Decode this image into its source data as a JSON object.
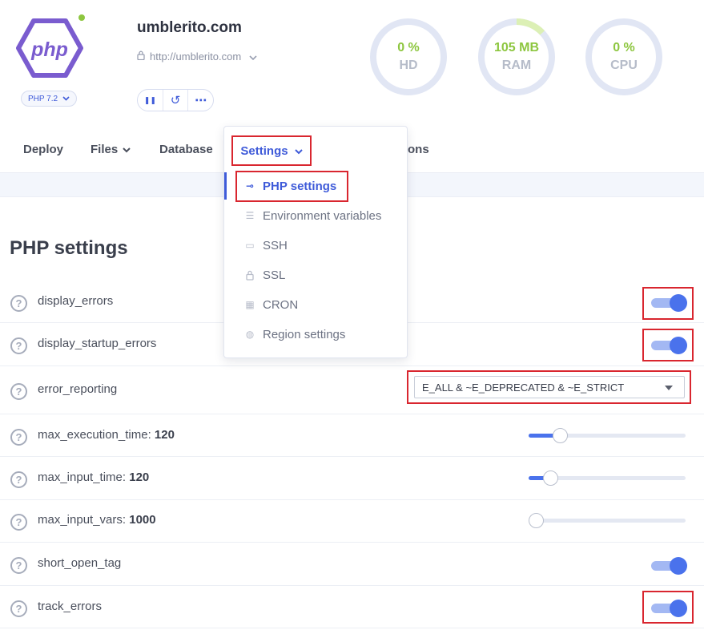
{
  "header": {
    "site_name": "umblerito.com",
    "url": "http://umblerito.com",
    "logo_text": "php",
    "php_version": "PHP 7.2",
    "status_color": "#8dc63f",
    "controls": [
      {
        "icon": "pause-icon",
        "glyph": "❚❚"
      },
      {
        "icon": "restart-icon",
        "glyph": "↺"
      },
      {
        "icon": "more-icon",
        "glyph": "⋯"
      }
    ]
  },
  "gauges": [
    {
      "value": "0 %",
      "label": "HD",
      "fraction": 0
    },
    {
      "value": "105 MB",
      "label": "RAM",
      "fraction": 0.13
    },
    {
      "value": "0 %",
      "label": "CPU",
      "fraction": 0
    }
  ],
  "nav": {
    "items": [
      "Deploy",
      "Files",
      "Database",
      "Settings"
    ],
    "hidden_suffix": "ons"
  },
  "dropdown": {
    "items": [
      {
        "label": "PHP settings",
        "icon": "key-icon",
        "glyph": "⊸"
      },
      {
        "label": "Environment variables",
        "icon": "sliders-icon",
        "glyph": "☰"
      },
      {
        "label": "SSH",
        "icon": "terminal-icon",
        "glyph": "▭"
      },
      {
        "label": "SSL",
        "icon": "lock-icon",
        "glyph": "🔒︎"
      },
      {
        "label": "CRON",
        "icon": "calendar-icon",
        "glyph": "▦"
      },
      {
        "label": "Region settings",
        "icon": "globe-icon",
        "glyph": "◍"
      }
    ]
  },
  "settings": {
    "title": "PHP settings",
    "help_glyph": "?",
    "rows": [
      {
        "name": "display_errors",
        "type": "toggle",
        "on": true
      },
      {
        "name": "display_startup_errors",
        "type": "toggle",
        "on": true
      },
      {
        "name": "error_reporting",
        "type": "select",
        "value": "E_ALL & ~E_DEPRECATED & ~E_STRICT"
      },
      {
        "name": "max_execution_time",
        "value": "120",
        "type": "slider",
        "fraction": 0.2
      },
      {
        "name": "max_input_time",
        "value": "120",
        "type": "slider",
        "fraction": 0.14
      },
      {
        "name": "max_input_vars",
        "value": "1000",
        "type": "slider",
        "fraction": 0.0
      },
      {
        "name": "short_open_tag",
        "type": "toggle",
        "on": true
      },
      {
        "name": "track_errors",
        "type": "toggle",
        "on": true
      }
    ]
  },
  "colors": {
    "accent": "#3f5bd9",
    "toggle_on": "#4a72ec",
    "highlight": "#d9262f",
    "gauge_green": "#8dc63f"
  }
}
